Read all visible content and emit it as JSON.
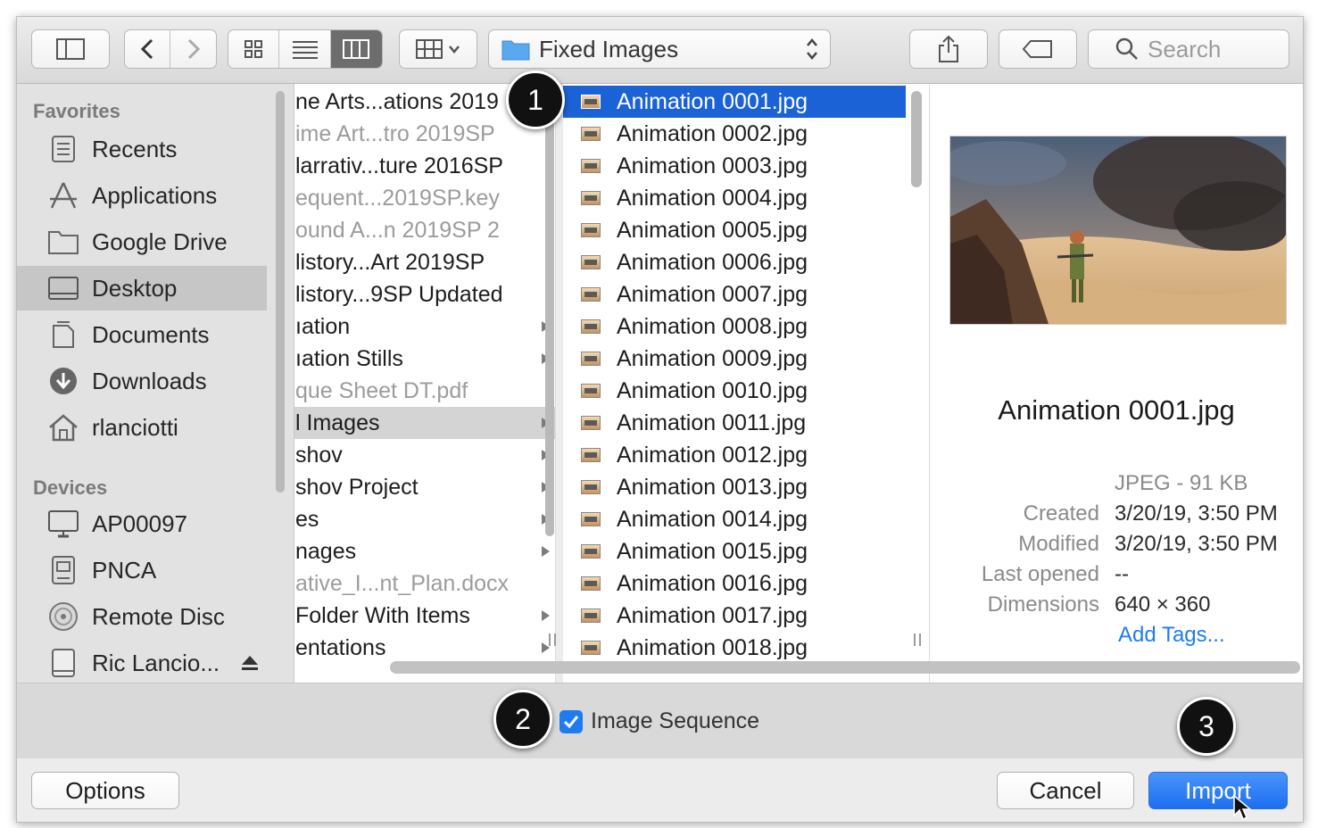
{
  "toolbar": {
    "path_label": "Fixed Images",
    "search_placeholder": "Search"
  },
  "sidebar": {
    "favorites_heading": "Favorites",
    "favorites": [
      {
        "label": "Recents",
        "icon": "recents-icon"
      },
      {
        "label": "Applications",
        "icon": "applications-icon"
      },
      {
        "label": "Google Drive",
        "icon": "folder-icon"
      },
      {
        "label": "Desktop",
        "icon": "desktop-icon",
        "selected": true
      },
      {
        "label": "Documents",
        "icon": "documents-icon"
      },
      {
        "label": "Downloads",
        "icon": "downloads-icon"
      },
      {
        "label": "rlanciotti",
        "icon": "home-icon"
      }
    ],
    "devices_heading": "Devices",
    "devices": [
      {
        "label": "AP00097",
        "icon": "computer-icon"
      },
      {
        "label": "PNCA",
        "icon": "drive-icon"
      },
      {
        "label": "Remote Disc",
        "icon": "disc-icon"
      },
      {
        "label": "Ric Lancio...",
        "icon": "external-drive-icon"
      }
    ]
  },
  "column1": [
    {
      "label": "ne Arts...ations 2019",
      "dim": false,
      "folder": false
    },
    {
      "label": "ime Art...tro 2019SP",
      "dim": true,
      "folder": false
    },
    {
      "label": "larrativ...ture 2016SP",
      "dim": false,
      "folder": false
    },
    {
      "label": "equent...2019SP.key",
      "dim": true,
      "folder": false
    },
    {
      "label": "ound A...n 2019SP 2",
      "dim": true,
      "folder": false
    },
    {
      "label": "listory...Art 2019SP",
      "dim": false,
      "folder": false
    },
    {
      "label": "listory...9SP Updated",
      "dim": false,
      "folder": false
    },
    {
      "label": "ıation",
      "dim": false,
      "folder": true
    },
    {
      "label": "ıation Stills",
      "dim": false,
      "folder": true
    },
    {
      "label": "que Sheet DT.pdf",
      "dim": true,
      "folder": false
    },
    {
      "label": "l Images",
      "dim": false,
      "folder": true,
      "selected": true
    },
    {
      "label": "shov",
      "dim": false,
      "folder": true
    },
    {
      "label": "shov Project",
      "dim": false,
      "folder": true
    },
    {
      "label": "es",
      "dim": false,
      "folder": true
    },
    {
      "label": "nages",
      "dim": false,
      "folder": true
    },
    {
      "label": "ative_I...nt_Plan.docx",
      "dim": true,
      "folder": false
    },
    {
      "label": " Folder With Items",
      "dim": false,
      "folder": true
    },
    {
      "label": "entations",
      "dim": false,
      "folder": true
    }
  ],
  "column2": [
    "Animation 0001.jpg",
    "Animation 0002.jpg",
    "Animation 0003.jpg",
    "Animation 0004.jpg",
    "Animation 0005.jpg",
    "Animation 0006.jpg",
    "Animation 0007.jpg",
    "Animation 0008.jpg",
    "Animation 0009.jpg",
    "Animation 0010.jpg",
    "Animation 0011.jpg",
    "Animation 0012.jpg",
    "Animation 0013.jpg",
    "Animation 0014.jpg",
    "Animation 0015.jpg",
    "Animation 0016.jpg",
    "Animation 0017.jpg",
    "Animation 0018.jpg"
  ],
  "preview": {
    "filename": "Animation 0001.jpg",
    "kind": "JPEG - 91 KB",
    "created_label": "Created",
    "created_value": "3/20/19, 3:50 PM",
    "modified_label": "Modified",
    "modified_value": "3/20/19, 3:50 PM",
    "last_opened_label": "Last opened",
    "last_opened_value": "--",
    "dimensions_label": "Dimensions",
    "dimensions_value": "640 × 360",
    "add_tags": "Add Tags..."
  },
  "options": {
    "image_sequence_label": "Image Sequence",
    "image_sequence_checked": true
  },
  "buttons": {
    "options": "Options",
    "cancel": "Cancel",
    "import": "Import"
  },
  "callouts": [
    "1",
    "2",
    "3"
  ],
  "colors": {
    "selection_blue": "#1b62d6",
    "link_blue": "#1f7cf0",
    "primary_button": "#1c6ff0"
  }
}
